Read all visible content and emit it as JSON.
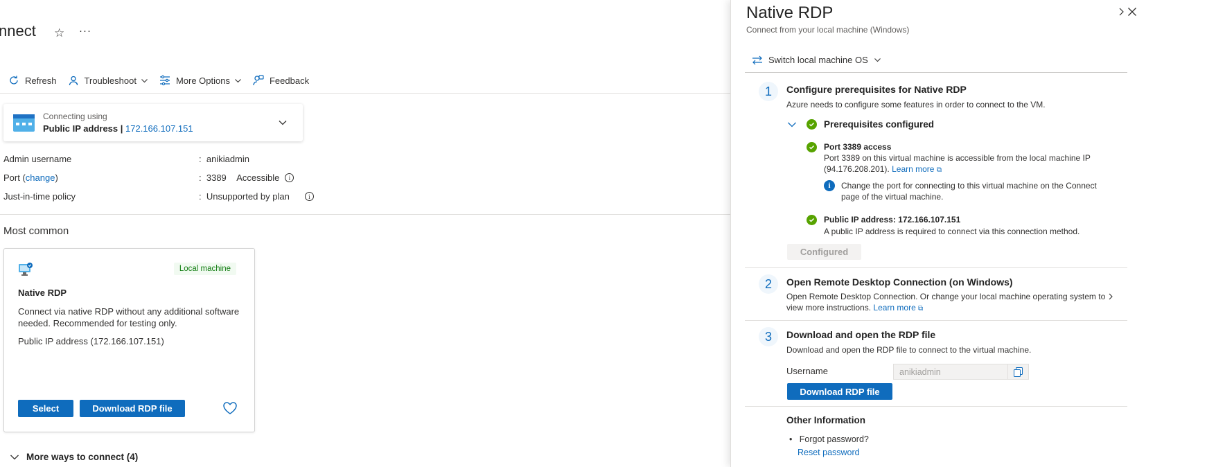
{
  "page": {
    "title": "nnect",
    "toolbar": {
      "refresh": "Refresh",
      "troubleshoot": "Troubleshoot",
      "more_options": "More Options",
      "feedback": "Feedback"
    },
    "connection": {
      "label": "Connecting using",
      "value_prefix": "Public IP address | ",
      "ip": "172.166.107.151"
    },
    "properties": {
      "admin_label": "Admin username",
      "admin_value": "anikiadmin",
      "port_label_prefix": "Port (",
      "port_change": "change",
      "port_label_suffix": ")",
      "port_value": "3389",
      "port_status": "Accessible",
      "jit_label": "Just-in-time policy",
      "jit_value": "Unsupported by plan",
      "separator": ":"
    },
    "most_common": "Most common",
    "card": {
      "badge": "Local machine",
      "title": "Native RDP",
      "description": "Connect via native RDP without any additional software needed. Recommended for testing only.",
      "ip_text": "Public IP address (172.166.107.151)",
      "select_label": "Select",
      "download_label": "Download RDP file"
    },
    "more_ways": "More ways to connect (4)"
  },
  "panel": {
    "title": "Native RDP",
    "subtitle": "Connect from your local machine (Windows)",
    "switch_os": "Switch local machine OS",
    "step1": {
      "num": "1",
      "title": "Configure prerequisites for Native RDP",
      "desc": "Azure needs to configure some features in order to connect to the VM.",
      "prereq_header": "Prerequisites configured",
      "port_title": "Port 3389 access",
      "port_desc_1": "Port 3389 on this virtual machine is accessible from the local machine IP",
      "port_desc_2": "(94.176.208.201).",
      "learn_more": "Learn more",
      "info_text": "Change the port for connecting to this virtual machine on the Connect page of the virtual machine.",
      "ip_title": "Public IP address: 172.166.107.151",
      "ip_desc": "A public IP address is required to connect via this connection method.",
      "configured_label": "Configured"
    },
    "step2": {
      "num": "2",
      "title": "Open Remote Desktop Connection (on Windows)",
      "desc_1": "Open Remote Desktop Connection. Or change your local machine operating system to",
      "desc_2": "view more instructions.",
      "learn_more": "Learn more"
    },
    "step3": {
      "num": "3",
      "title": "Download and open the RDP file",
      "desc": "Download and open the RDP file to connect to the virtual machine.",
      "username_label": "Username",
      "username_value": "anikiadmin",
      "download_label": "Download RDP file"
    },
    "other": {
      "title": "Other Information",
      "forgot": "Forgot password?",
      "reset": "Reset password"
    }
  },
  "colors": {
    "accent": "#0f6cbd",
    "success": "#57a300",
    "badge_green": "#107c10"
  }
}
